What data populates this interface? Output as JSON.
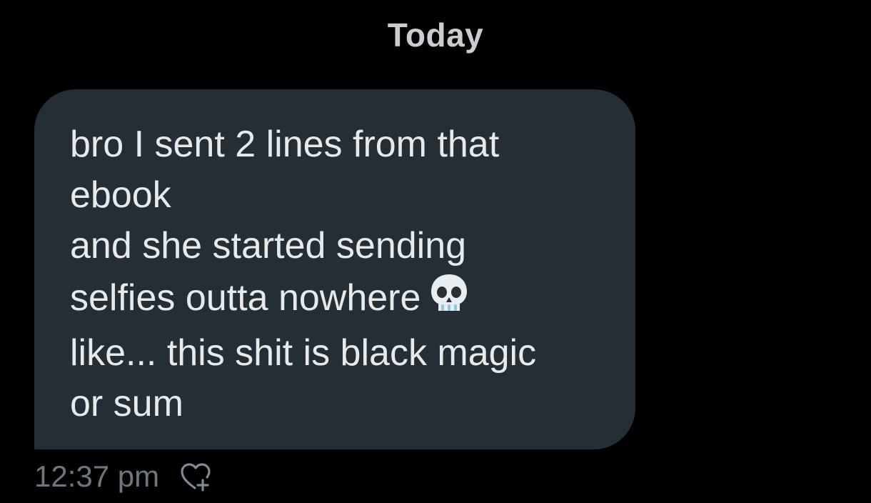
{
  "conversation": {
    "date_label": "Today",
    "message": {
      "lines": [
        "bro I sent 2 lines from that",
        "ebook",
        "and she started sending",
        "selfies outta nowhere",
        "like... this shit is black magic",
        "or sum"
      ],
      "emoji": "skull-emoji",
      "timestamp": "12:37 pm",
      "react_icon": "heart-plus-icon"
    }
  },
  "colors": {
    "background": "#000000",
    "bubble": "#252d35",
    "message_text": "#e7e9ea",
    "date_text": "#c9cdd1",
    "meta_text": "#6e767d"
  }
}
